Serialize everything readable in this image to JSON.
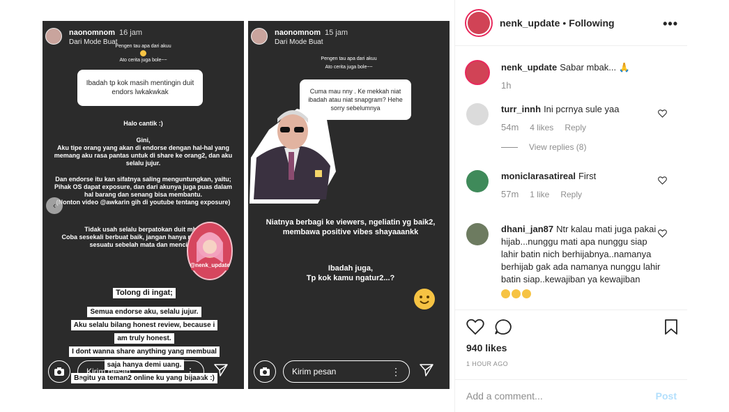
{
  "story1": {
    "username": "naonomnom",
    "time": "16 jam",
    "sub": "Dari Mode Buat",
    "tiny1": "Pengen tau apa dari akuu",
    "tiny2": "Ato cerita juga bole~~",
    "question": "Ibadah tp kok masih mentingin duit endors lwkakwkak",
    "p1": "Halo cantik :)",
    "p2": "Gini,\nAku tipe orang yang akan di endorse dengan hal-hal yang memang aku rasa pantas untuk di share ke orang2, dan aku selalu jujur.",
    "p3": "Dan endorse itu kan sifatnya saling menguntungkan, yaitu;\nPihak OS dapat exposure, dan dari akunya juga puas dalam hal barang dan senang bisa membantu.\n(Nonton video @awkarin gih di youtube tentang exposure)",
    "p4": "Tidak usah selalu berpatokan duit mba.\nCoba sesekali berbuat baik, jangan hanya memandang sesuatu sebelah mata dan mencibir.",
    "h1": "Tolong di ingat;",
    "h2": "Semua endorse aku, selalu jujur.",
    "h3": "Aku selalu bilang honest review, because i",
    "h4": "am truly honest.",
    "h5": "I dont wanna share anything yang membual",
    "h6": "saja hanya demi uang.",
    "h7": "Begitu ya teman2 online ku yang bijaaak :)",
    "sticker": "@nenk_update",
    "placeholder": "Kirim pesan"
  },
  "story2": {
    "username": "naonomnom",
    "time": "15 jam",
    "sub": "Dari Mode Buat",
    "tiny1": "Pengen tau apa dari akuu",
    "tiny2": "Ato cerita juga bole~~",
    "question": "Cuma mau nny . Ke mekkah niat ibadah atau niat snapgram? Hehe sorry sebelumnya",
    "p1": "Niatnya berbagi ke viewers, ngeliatin yg baik2, membawa positive vibes shayaaankk",
    "p2": "Ibadah juga,\nTp kok kamu ngatur2...?",
    "placeholder": "Kirim pesan"
  },
  "header": {
    "username": "nenk_update",
    "separator": "•",
    "following": "Following",
    "more": "•••"
  },
  "comments": [
    {
      "user": "nenk_update",
      "text": "Sabar mbak...",
      "time": "1h",
      "likes": "",
      "reply": ""
    },
    {
      "user": "turr_innh",
      "text": "Ini pcrnya sule yaa",
      "time": "54m",
      "likes": "4 likes",
      "reply": "Reply",
      "view_replies": "View replies (8)"
    },
    {
      "user": "moniclarasatireal",
      "text": "First",
      "time": "57m",
      "likes": "1 like",
      "reply": "Reply"
    },
    {
      "user": "dhani_jan87",
      "text": "Ntr kalau mati juga pakai hijab...nunggu mati apa nunggu siap lahir batin nich berhijabnya..namanya berhijab gak ada namanya nunggu lahir batin siap..kewajiban ya kewajiban"
    }
  ],
  "post": {
    "likes": "940 likes",
    "ago": "1 HOUR AGO",
    "add_comment": "Add a comment...",
    "post_label": "Post"
  },
  "colors": {
    "story_bg": "#2b2b2b",
    "ring": "#e8295c",
    "post_disabled": "#b2dffc",
    "meta_gray": "#8e8e8e"
  }
}
